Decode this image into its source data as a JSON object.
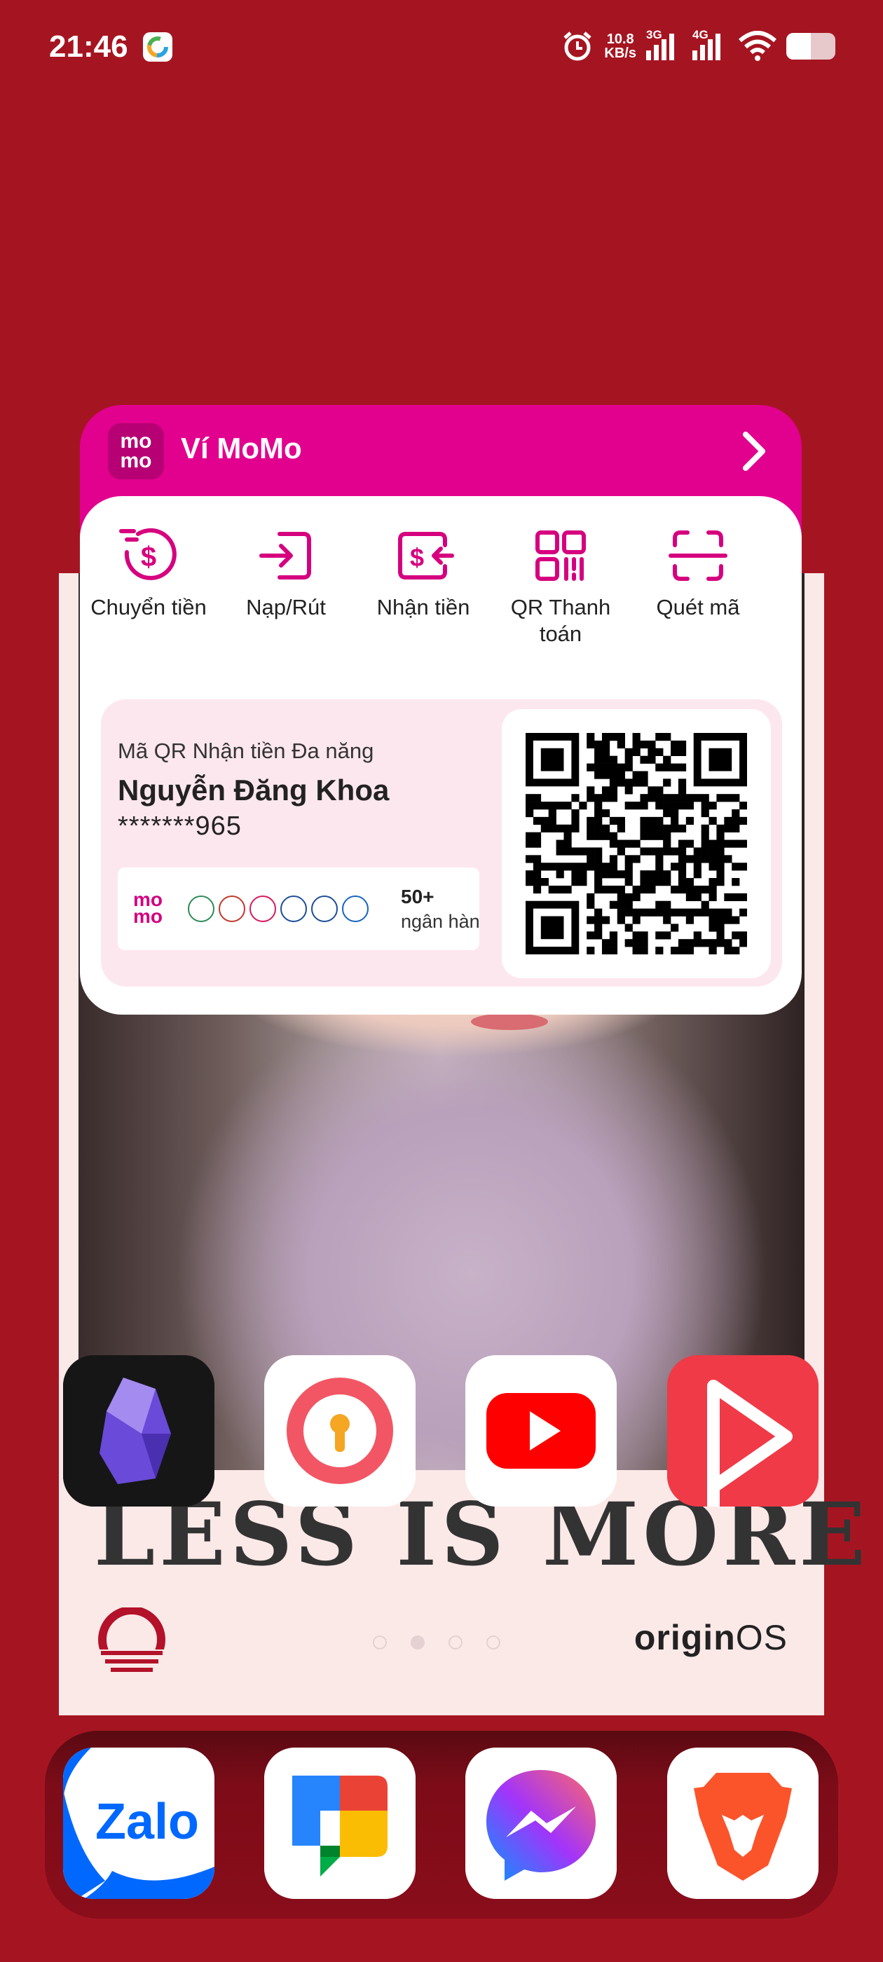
{
  "status_bar": {
    "time": "21:46",
    "net_speed_value": "10.8",
    "net_speed_unit": "KB/s",
    "signal1_label": "3G",
    "signal2_label": "4G"
  },
  "momo": {
    "title": "Ví MoMo",
    "logo_text_top": "mo",
    "logo_text_bottom": "mo",
    "actions": [
      {
        "label": "Chuyển tiền"
      },
      {
        "label": "Nạp/Rút"
      },
      {
        "label": "Nhận tiền"
      },
      {
        "label": "QR Thanh toán"
      },
      {
        "label": "Quét mã"
      }
    ],
    "qr_card": {
      "label": "Mã QR Nhận tiền Đa năng",
      "name": "Nguyễn Đăng Khoa",
      "account": "*******965",
      "bank_count": "50+",
      "bank_unit": "ngân hàng"
    }
  },
  "wallpaper": {
    "slogan": "LESS IS MORE",
    "os_brand_bold": "origin",
    "os_brand_light": "OS",
    "page_count": 4,
    "active_page": 2
  },
  "apps_row": [
    {
      "icon": "obsidian-icon"
    },
    {
      "icon": "keyhole-app-icon"
    },
    {
      "icon": "youtube-icon"
    },
    {
      "icon": "video-player-icon"
    }
  ],
  "dock": [
    {
      "icon": "zalo-icon",
      "text": "Zalo"
    },
    {
      "icon": "google-chat-icon"
    },
    {
      "icon": "messenger-icon"
    },
    {
      "icon": "brave-icon"
    }
  ],
  "colors": {
    "background": "#a51521",
    "momo_pink": "#e2008e",
    "qr_card_bg": "#fde7ee"
  }
}
